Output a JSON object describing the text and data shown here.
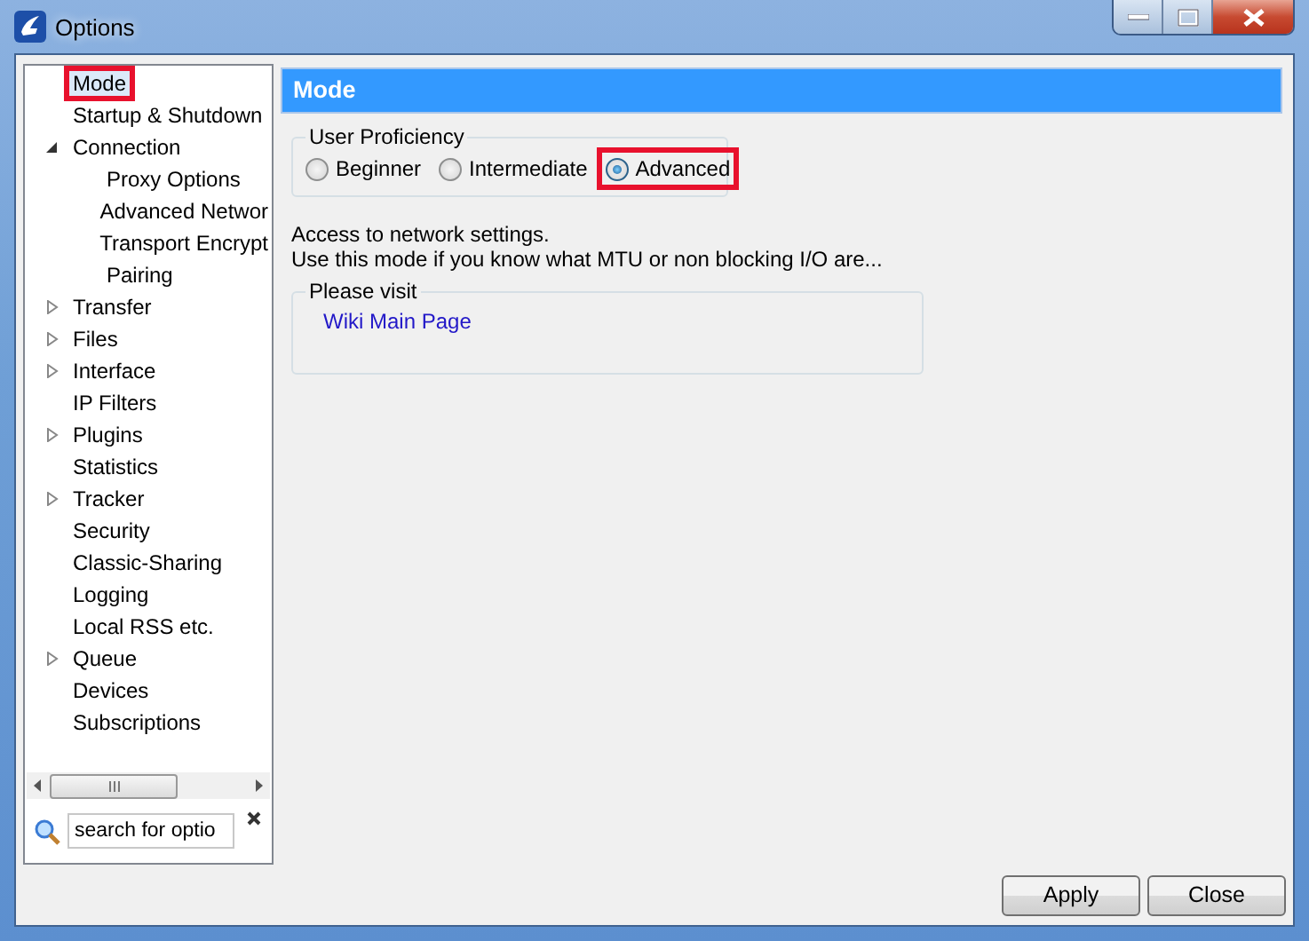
{
  "window": {
    "title": "Options"
  },
  "tree": [
    {
      "label": "Mode",
      "kind": "page",
      "selected": true,
      "highlighted": true
    },
    {
      "label": "Startup & Shutdown",
      "kind": "page",
      "selected": false,
      "highlighted": false
    },
    {
      "label": "Connection",
      "kind": "group",
      "expanded": true,
      "selected": false,
      "highlighted": false,
      "children": [
        {
          "label": "Proxy Options",
          "kind": "page",
          "selected": false,
          "highlighted": false
        },
        {
          "label": "Advanced Networ",
          "kind": "page",
          "selected": false,
          "highlighted": false
        },
        {
          "label": "Transport Encrypt",
          "kind": "page",
          "selected": false,
          "highlighted": false
        },
        {
          "label": "Pairing",
          "kind": "page",
          "selected": false,
          "highlighted": false
        }
      ]
    },
    {
      "label": "Transfer",
      "kind": "group",
      "expanded": false,
      "selected": false,
      "highlighted": false
    },
    {
      "label": "Files",
      "kind": "group",
      "expanded": false,
      "selected": false,
      "highlighted": false
    },
    {
      "label": "Interface",
      "kind": "group",
      "expanded": false,
      "selected": false,
      "highlighted": false
    },
    {
      "label": "IP Filters",
      "kind": "page",
      "selected": false,
      "highlighted": false
    },
    {
      "label": "Plugins",
      "kind": "group",
      "expanded": false,
      "selected": false,
      "highlighted": false
    },
    {
      "label": "Statistics",
      "kind": "page",
      "selected": false,
      "highlighted": false
    },
    {
      "label": "Tracker",
      "kind": "group",
      "expanded": false,
      "selected": false,
      "highlighted": false
    },
    {
      "label": "Security",
      "kind": "page",
      "selected": false,
      "highlighted": false
    },
    {
      "label": "Classic-Sharing",
      "kind": "page",
      "selected": false,
      "highlighted": false
    },
    {
      "label": "Logging",
      "kind": "page",
      "selected": false,
      "highlighted": false
    },
    {
      "label": "Local RSS etc.",
      "kind": "page",
      "selected": false,
      "highlighted": false
    },
    {
      "label": "Queue",
      "kind": "group",
      "expanded": false,
      "selected": false,
      "highlighted": false
    },
    {
      "label": "Devices",
      "kind": "page",
      "selected": false,
      "highlighted": false
    },
    {
      "label": "Subscriptions",
      "kind": "page",
      "selected": false,
      "highlighted": false
    }
  ],
  "search": {
    "value": "search for optio"
  },
  "panel": {
    "title": "Mode",
    "proficiency": {
      "label": "User Proficiency",
      "options": [
        {
          "label": "Beginner",
          "selected": false,
          "highlighted": false
        },
        {
          "label": "Intermediate",
          "selected": false,
          "highlighted": false
        },
        {
          "label": "Advanced",
          "selected": true,
          "highlighted": true
        }
      ]
    },
    "description": [
      "Access to network settings.",
      "Use this mode if you know what MTU or non blocking I/O are..."
    ],
    "visit": {
      "label": "Please visit",
      "link": "Wiki Main Page"
    }
  },
  "buttons": [
    "Apply",
    "Close"
  ]
}
